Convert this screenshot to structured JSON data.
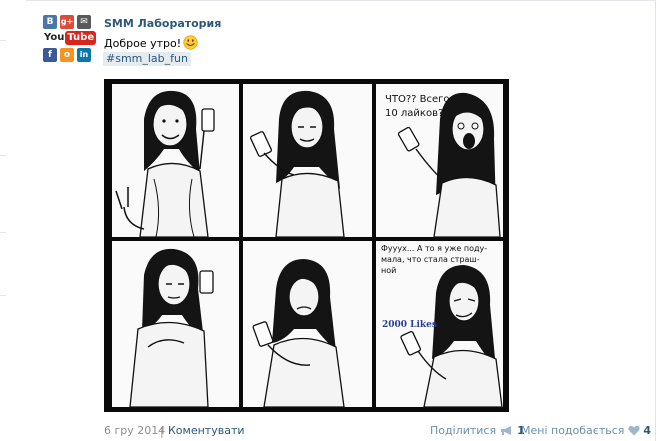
{
  "post": {
    "author": "SMM Лаборатория",
    "text": "Доброе утро!",
    "emoji": "smile-emoji",
    "hashtag": "#smm_lab_fun",
    "avatar": {
      "tiles": [
        "B",
        "g+",
        "✉",
        "f",
        "о",
        "in"
      ],
      "youtube_you": "You",
      "youtube_tube": "Tube",
      "colors": [
        "#4a76a8",
        "#dd4b39",
        "#5a5a5a",
        "#3b5998",
        "#f7931e",
        "#0e76a8"
      ]
    },
    "comic": {
      "bubble_top_right": [
        "ЧТО?? Всего",
        "10 лайков?"
      ],
      "bubble_bottom_right": [
        "Фууух... А то я уже поду-",
        "мала, что стала страш-",
        "ной"
      ],
      "likes_label": "2000 Likes"
    }
  },
  "footer": {
    "date": "6 гру 2014",
    "separator": "|",
    "comment_label": "Коментувати",
    "share_label": "Поділитися",
    "share_count": "1",
    "like_label": "Мені подобається",
    "like_count": "4"
  }
}
